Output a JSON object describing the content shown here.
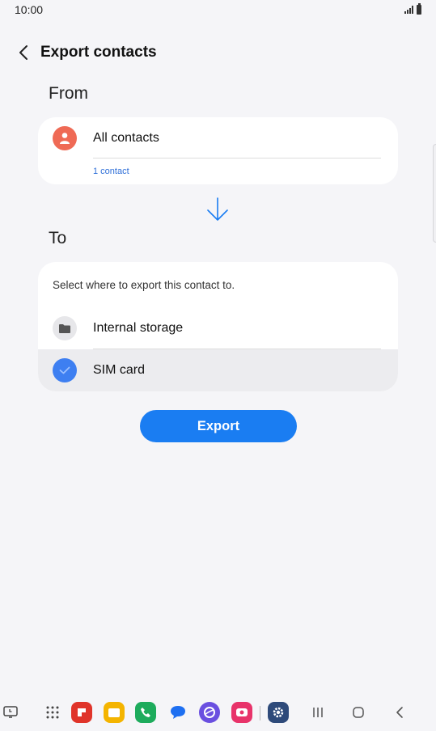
{
  "status_bar": {
    "time": "10:00"
  },
  "header": {
    "title": "Export contacts"
  },
  "from_section": {
    "label": "From",
    "source_label": "All contacts",
    "contact_count": "1 contact"
  },
  "to_section": {
    "label": "To",
    "hint": "Select where to export this contact to.",
    "options": [
      {
        "label": "Internal storage",
        "icon": "folder-icon",
        "selected": false
      },
      {
        "label": "SIM card",
        "icon": "check-icon",
        "selected": true
      }
    ]
  },
  "export_button": {
    "label": "Export"
  },
  "colors": {
    "accent": "#1a7df2",
    "contact_icon": "#ef6a55",
    "link": "#2f6fd8",
    "selected_row": "#ececef"
  },
  "taskbar": {
    "apps": [
      "recent-apps-icon",
      "app-grid-icon",
      "flipboard-app-icon",
      "files-app-icon",
      "phone-app-icon",
      "messages-app-icon",
      "internet-app-icon",
      "screen-recorder-app-icon",
      "settings-app-icon"
    ],
    "nav": [
      "recents-nav-icon",
      "home-nav-icon",
      "back-nav-icon"
    ]
  }
}
